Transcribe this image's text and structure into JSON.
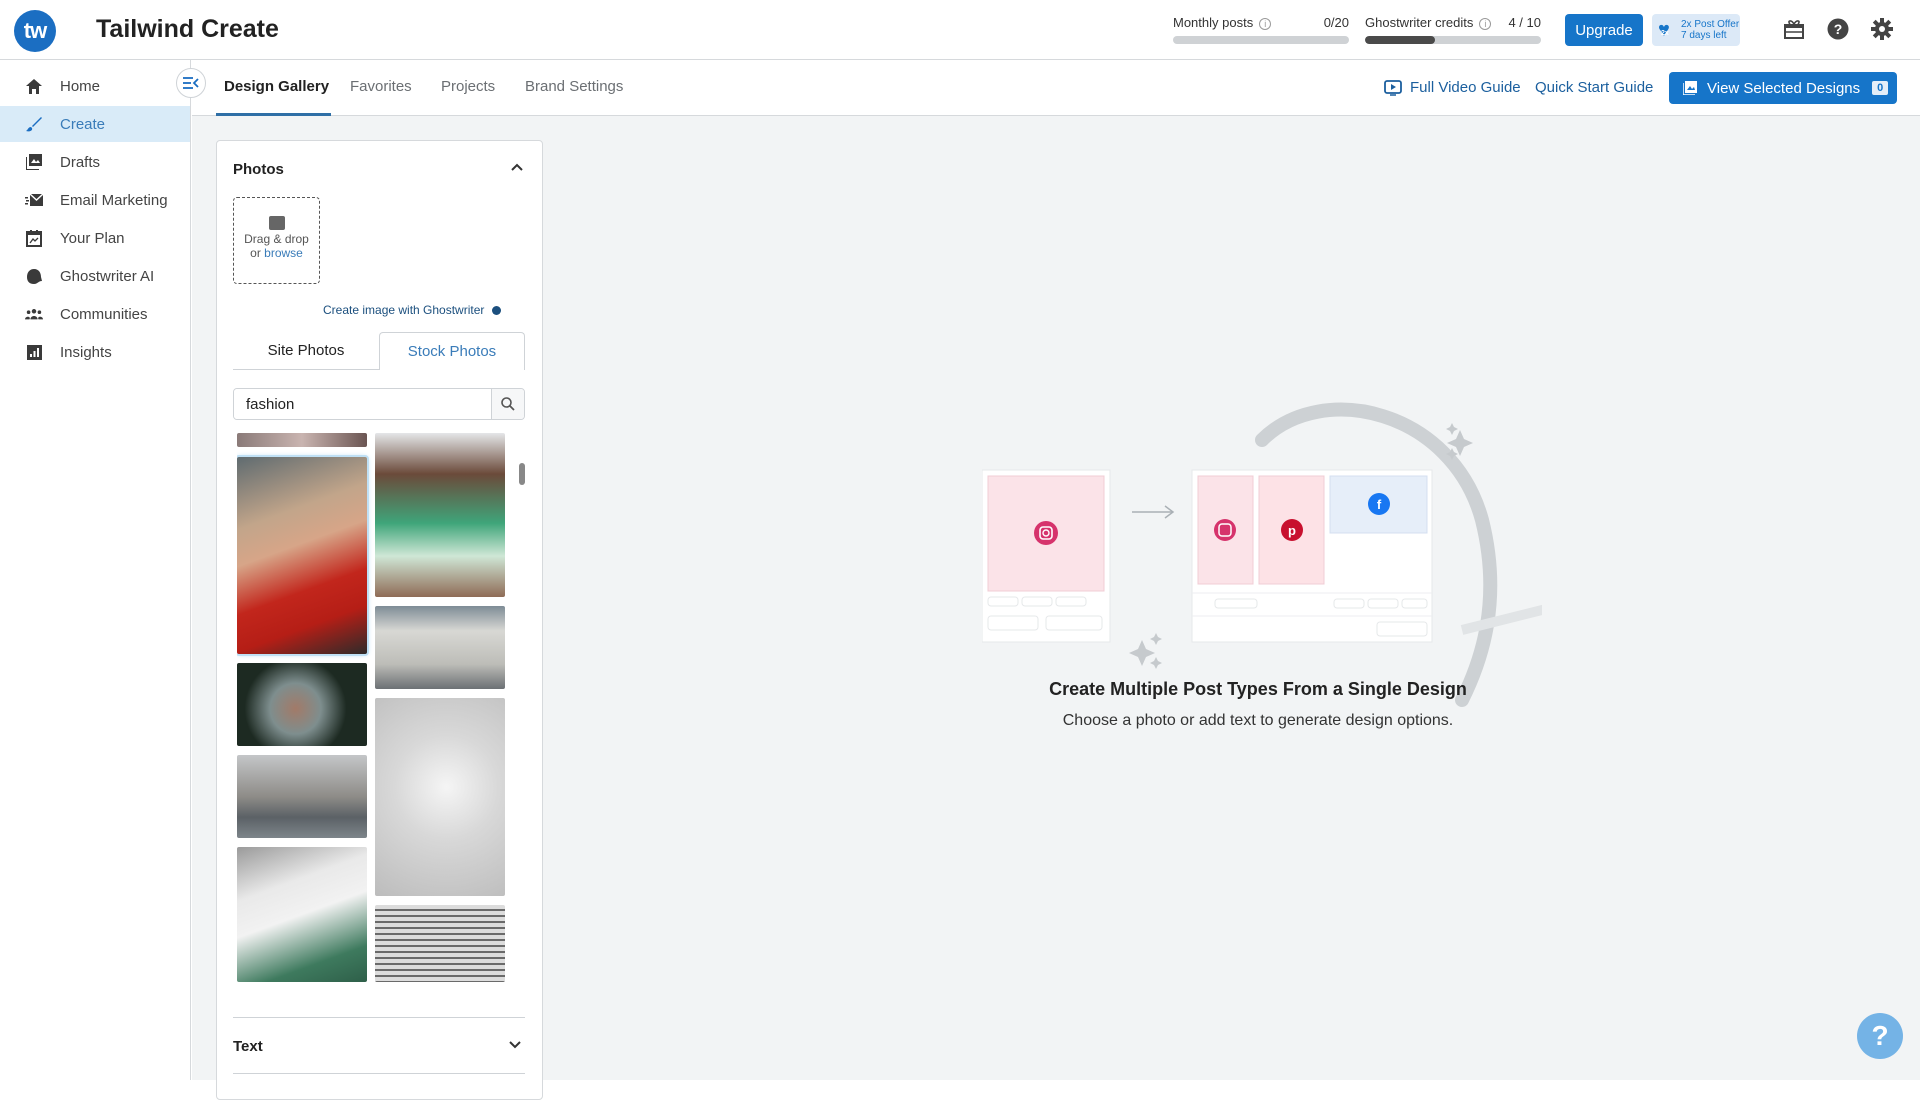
{
  "header": {
    "logo_text": "tw",
    "app_title": "Tailwind Create",
    "usage": [
      {
        "label": "Monthly posts",
        "value": "0/20",
        "progress": 0.0
      },
      {
        "label": "Ghostwriter credits",
        "value": "4 / 10",
        "progress": 0.4
      }
    ],
    "upgrade_label": "Upgrade",
    "offer": {
      "badge": "2x",
      "line1": "2x Post Offer",
      "line2": "7 days left"
    },
    "icons": [
      "gift-icon",
      "help-icon",
      "settings-icon"
    ]
  },
  "sidebar": {
    "items": [
      {
        "label": "Home",
        "icon": "home-icon",
        "active": false
      },
      {
        "label": "Create",
        "icon": "brush-icon",
        "active": true
      },
      {
        "label": "Drafts",
        "icon": "drafts-icon",
        "active": false
      },
      {
        "label": "Email Marketing",
        "icon": "email-icon",
        "active": false
      },
      {
        "label": "Your Plan",
        "icon": "calendar-icon",
        "active": false
      },
      {
        "label": "Ghostwriter AI",
        "icon": "ghostwriter-icon",
        "active": false
      },
      {
        "label": "Communities",
        "icon": "communities-icon",
        "active": false
      },
      {
        "label": "Insights",
        "icon": "insights-icon",
        "active": false
      }
    ]
  },
  "tabs": [
    {
      "label": "Design Gallery",
      "active": true
    },
    {
      "label": "Favorites",
      "active": false
    },
    {
      "label": "Projects",
      "active": false
    },
    {
      "label": "Brand Settings",
      "active": false
    }
  ],
  "toolbar": {
    "full_video_guide": "Full Video Guide",
    "quick_start_guide": "Quick Start Guide",
    "view_selected": "View Selected Designs",
    "selected_count": "0"
  },
  "photos_panel": {
    "title": "Photos",
    "dropzone_line1": "Drag & drop",
    "dropzone_or": "or ",
    "dropzone_browse": "browse",
    "ghostwriter_link": "Create image with Ghostwriter",
    "subtabs": [
      {
        "label": "Site Photos",
        "active": false
      },
      {
        "label": "Stock Photos",
        "active": true
      }
    ],
    "search_value": "fashion",
    "text_section_title": "Text"
  },
  "empty_state": {
    "title": "Create Multiple Post Types From a Single Design",
    "subtitle": "Choose a photo or add text to generate design options."
  },
  "colors": {
    "brand": "#1675c9",
    "active_bg": "#d9ebf8",
    "instagram": "#d6336c",
    "pinterest": "#c8102e",
    "facebook": "#1877f2"
  }
}
